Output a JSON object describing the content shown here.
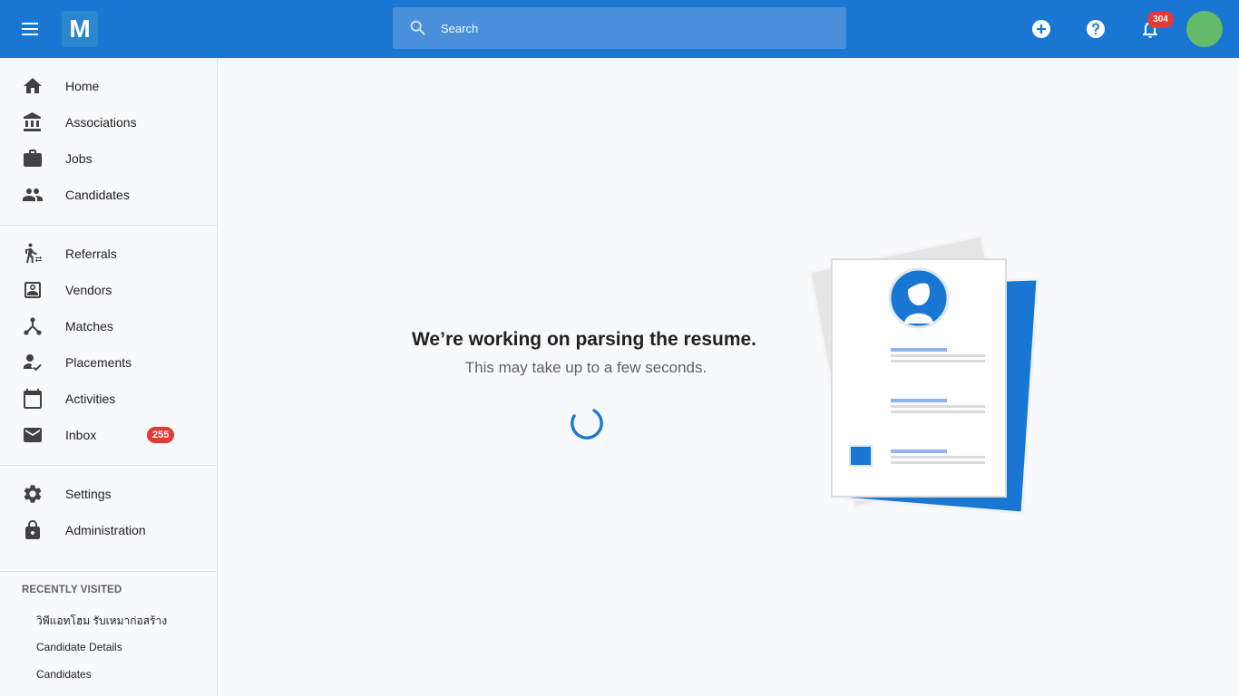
{
  "app": {
    "logo_letter": "M",
    "brand_color": "#1976d2"
  },
  "header": {
    "search_placeholder": "Search",
    "notification_count": "304",
    "icons": [
      "menu-icon",
      "search-icon",
      "add-circle-icon",
      "help-icon",
      "bell-icon",
      "user-avatar"
    ]
  },
  "sidebar": {
    "items": [
      {
        "label": "Home",
        "icon": "home-icon"
      },
      {
        "label": "Associations",
        "icon": "bank-icon"
      },
      {
        "label": "Jobs",
        "icon": "briefcase-icon"
      },
      {
        "label": "Candidates",
        "icon": "people-icon"
      },
      {
        "label": "Referrals",
        "icon": "walk-transfer-icon"
      },
      {
        "label": "Vendors",
        "icon": "contact-box-icon"
      },
      {
        "label": "Matches",
        "icon": "network-icon"
      },
      {
        "label": "Placements",
        "icon": "person-check-icon"
      },
      {
        "label": "Activities",
        "icon": "calendar-icon"
      },
      {
        "label": "Inbox",
        "icon": "mail-icon",
        "badge": "255"
      },
      {
        "label": "Settings",
        "icon": "gear-icon"
      },
      {
        "label": "Administration",
        "icon": "lock-icon"
      }
    ],
    "recently_visited_title": "RECENTLY VISITED",
    "recent": [
      "วิพีแอทโฮม รับเหมาก่อสร้าง",
      "Candidate Details",
      "Candidates"
    ]
  },
  "main": {
    "title": "We’re working on parsing the resume.",
    "subtitle": "This may take up to a few seconds."
  }
}
